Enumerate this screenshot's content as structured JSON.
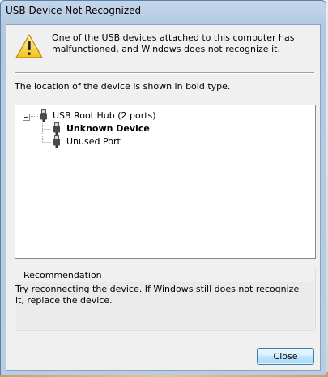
{
  "window": {
    "title": "USB Device Not Recognized"
  },
  "message": {
    "icon": "warning-icon",
    "text": "One of the USB devices attached to this computer has malfunctioned, and Windows does not recognize it."
  },
  "location_text": "The location of the device is shown in bold type.",
  "tree": {
    "root": {
      "label": "USB Root Hub (2 ports)",
      "expanded": true,
      "icon": "usb-connector-icon"
    },
    "children": [
      {
        "label": "Unknown Device",
        "bold": true,
        "icon": "usb-connector-icon"
      },
      {
        "label": "Unused Port",
        "bold": false,
        "icon": "usb-connector-icon"
      }
    ]
  },
  "recommendation": {
    "label": "Recommendation",
    "text": "Try reconnecting the device. If Windows still does not recognize it, replace the device."
  },
  "buttons": {
    "close_label": "Close"
  },
  "colors": {
    "titlebar": "#b8cce3",
    "client": "#f0f0f0",
    "button_accent": "#3c7fb1"
  }
}
